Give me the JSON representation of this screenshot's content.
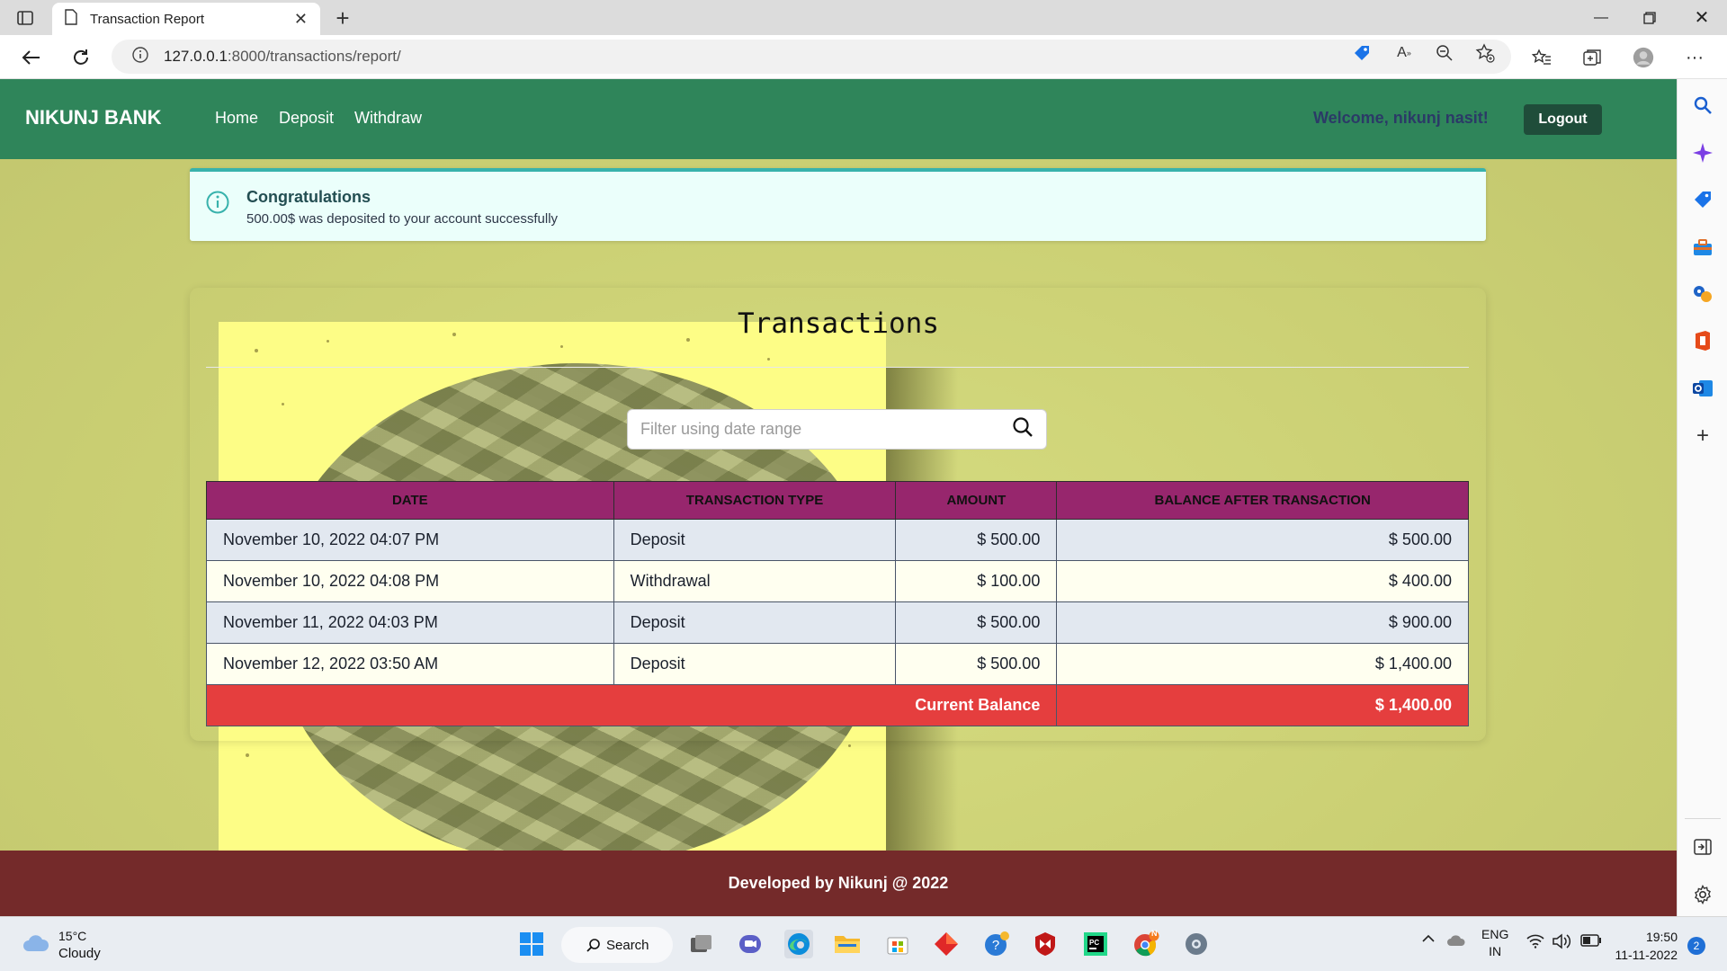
{
  "browser": {
    "tab_title": "Transaction Report",
    "url_host": "127.0.0.1",
    "url_path": ":8000/transactions/report/"
  },
  "navbar": {
    "brand": "NIKUNJ BANK",
    "links": [
      "Home",
      "Deposit",
      "Withdraw"
    ],
    "welcome": "Welcome, nikunj nasit!",
    "logout": "Logout"
  },
  "alert": {
    "title": "Congratulations",
    "message": "500.00$ was deposited to your account successfully"
  },
  "report": {
    "title": "Transactions",
    "search_placeholder": "Filter using date range",
    "headers": [
      "DATE",
      "TRANSACTION TYPE",
      "AMOUNT",
      "BALANCE AFTER TRANSACTION"
    ],
    "rows": [
      {
        "date": "November 10, 2022 04:07 PM",
        "type": "Deposit",
        "amount": "$ 500.00",
        "balance": "$ 500.00"
      },
      {
        "date": "November 10, 2022 04:08 PM",
        "type": "Withdrawal",
        "amount": "$ 100.00",
        "balance": "$ 400.00"
      },
      {
        "date": "November 11, 2022 04:03 PM",
        "type": "Deposit",
        "amount": "$ 500.00",
        "balance": "$ 900.00"
      },
      {
        "date": "November 12, 2022 03:50 AM",
        "type": "Deposit",
        "amount": "$ 500.00",
        "balance": "$ 1,400.00"
      }
    ],
    "total_label": "Current Balance",
    "total_value": "$ 1,400.00"
  },
  "footer": {
    "text": "Developed by Nikunj @ 2022"
  },
  "taskbar": {
    "weather_temp": "15°C",
    "weather_desc": "Cloudy",
    "search_label": "Search",
    "lang_top": "ENG",
    "lang_bottom": "IN",
    "time": "19:50",
    "date": "11-11-2022",
    "notifications": "2",
    "chrome_badge": "N"
  },
  "colors": {
    "navbar": "#2f855a",
    "header_row": "#97266d",
    "total_row": "#e53e3e",
    "footer": "#742a2a",
    "page_bg": "#cacf73"
  }
}
